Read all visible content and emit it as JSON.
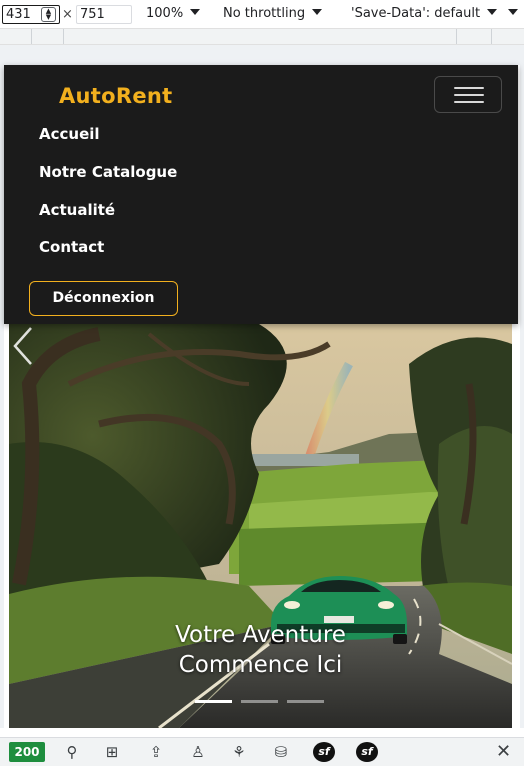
{
  "devtools": {
    "width_value": "431",
    "times": "×",
    "height_value": "751",
    "zoom": "100%",
    "throttling": "No throttling",
    "save_data": "'Save-Data': default",
    "status_code": "200"
  },
  "navbar": {
    "brand": "AutoRent",
    "links": [
      "Accueil",
      "Notre Catalogue",
      "Actualité",
      "Contact"
    ],
    "logout_label": "Déconnexion"
  },
  "hero": {
    "caption_line1": "Votre Aventure",
    "caption_line2": "Commence Ici",
    "plate": "ZUWIBA",
    "slide_count": 3,
    "active_slide": 0
  },
  "colors": {
    "brand_accent": "#f2b01e",
    "navbar_bg": "#1b1b1b",
    "car_green": "#1d8f56",
    "status_green": "#1e8e3e"
  },
  "icons": [
    "caret-down-icon",
    "chevron-left-icon",
    "network-icon",
    "cpu-icon",
    "upload-icon",
    "user-icon",
    "sprout-icon",
    "database-icon",
    "symfony-icon",
    "close-icon"
  ]
}
